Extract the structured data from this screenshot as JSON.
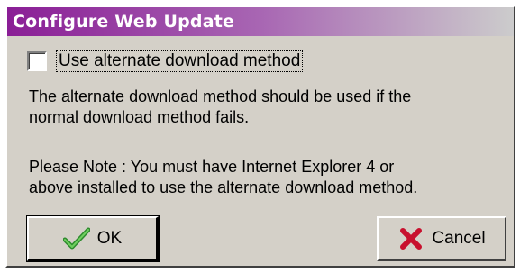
{
  "window": {
    "title": "Configure Web Update"
  },
  "option": {
    "checkbox_label": "Use alternate download method",
    "checked": false
  },
  "description": {
    "lines": [
      "The alternate download method should be used if the",
      "normal download method fails."
    ]
  },
  "note": {
    "lines": [
      "Please Note : You must have Internet Explorer 4 or",
      "above installed to use the alternate download method."
    ]
  },
  "buttons": {
    "ok_label": "OK",
    "ok_icon": "checkmark-icon",
    "cancel_label": "Cancel",
    "cancel_icon": "x-mark-icon"
  },
  "colors": {
    "title_gradient_start": "#8a1e96",
    "face": "#d4d0c8",
    "ok_check": "#2e8b2e",
    "cancel_x": "#c8102e"
  }
}
